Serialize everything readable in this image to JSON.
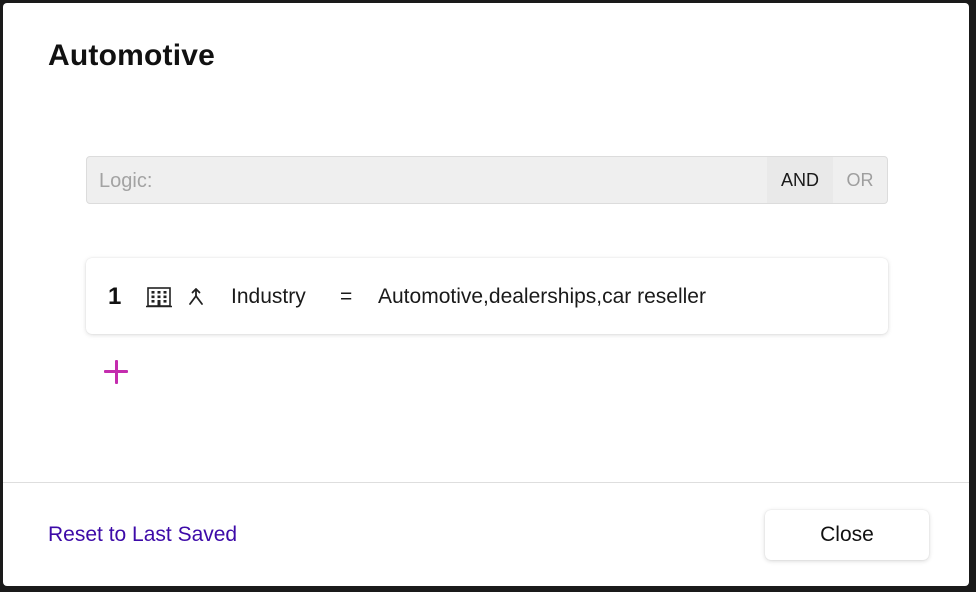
{
  "dialog": {
    "title": "Automotive"
  },
  "logic": {
    "label": "Logic:",
    "options": [
      "AND",
      "OR"
    ],
    "selected": "AND"
  },
  "rules": [
    {
      "index": "1",
      "icons": [
        "building-icon",
        "merge-icon"
      ],
      "field": "Industry",
      "operator": "=",
      "value": "Automotive,dealerships,car reseller"
    }
  ],
  "add_rule_icon": "plus-icon",
  "footer": {
    "reset_label": "Reset to Last Saved",
    "close_label": "Close"
  },
  "colors": {
    "accent_plus": "#c42cae",
    "link": "#3d0aa8",
    "logic_bar_bg": "#efefef"
  }
}
